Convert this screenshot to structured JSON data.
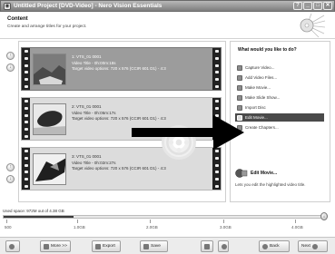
{
  "window": {
    "title": "Untitled Project [DVD-Video] - Nero Vision Essentials",
    "controls": [
      "?",
      "_",
      "□",
      "✕"
    ]
  },
  "header": {
    "title": "Content",
    "subtitle": "Create and arrange titles for your project."
  },
  "side_controls": [
    "↑",
    "↓"
  ],
  "titles": [
    {
      "name": "1: VTS_01 0001",
      "video_title": "Video Title - 0h:00m:18s",
      "target": "Target video options: 720 x 576 (CCIR 601 D1) - 4:3"
    },
    {
      "name": "2: VTS_01 0001",
      "video_title": "Video Title - 0h:05m:17s",
      "target": "Target video options: 720 x 576 (CCIR 601 D1) - 4:3"
    },
    {
      "name": "3: VTS_01 0001",
      "video_title": "Video Title - 0h:02m:27s",
      "target": "Target video options: 720 x 576 (CCIR 601 D1) - 4:3"
    }
  ],
  "task_panel": {
    "title": "What would you like to do?",
    "tasks": [
      {
        "label": "Capture Video...",
        "icon": "camera-icon"
      },
      {
        "label": "Add Video Files...",
        "icon": "add-file-icon"
      },
      {
        "label": "Make Movie...",
        "icon": "film-icon"
      },
      {
        "label": "Make Slide Show...",
        "icon": "slides-icon"
      },
      {
        "label": "Import Disc",
        "icon": "disc-icon"
      },
      {
        "label": "Edit Movie...",
        "icon": "edit-icon",
        "active": true
      },
      {
        "label": "Create Chapters...",
        "icon": "chapters-icon"
      }
    ],
    "help_title": "Edit Movie...",
    "help_desc": "Lets you edit the highlighted video title."
  },
  "disc": {
    "space_label": "Used space: 972M out of 4.38 GB",
    "used_fraction": 0.217,
    "ticks": [
      "500",
      "1.0GB",
      "2.0GB",
      "3.0GB",
      "4.0GB"
    ]
  },
  "bottombar": {
    "more_label": "More >>",
    "export_label": "Export",
    "save_label": "Save",
    "back_label": "Back",
    "next_label": "Next"
  },
  "colors": {
    "selection": "#9c9c9c",
    "arrow": "#000000"
  }
}
